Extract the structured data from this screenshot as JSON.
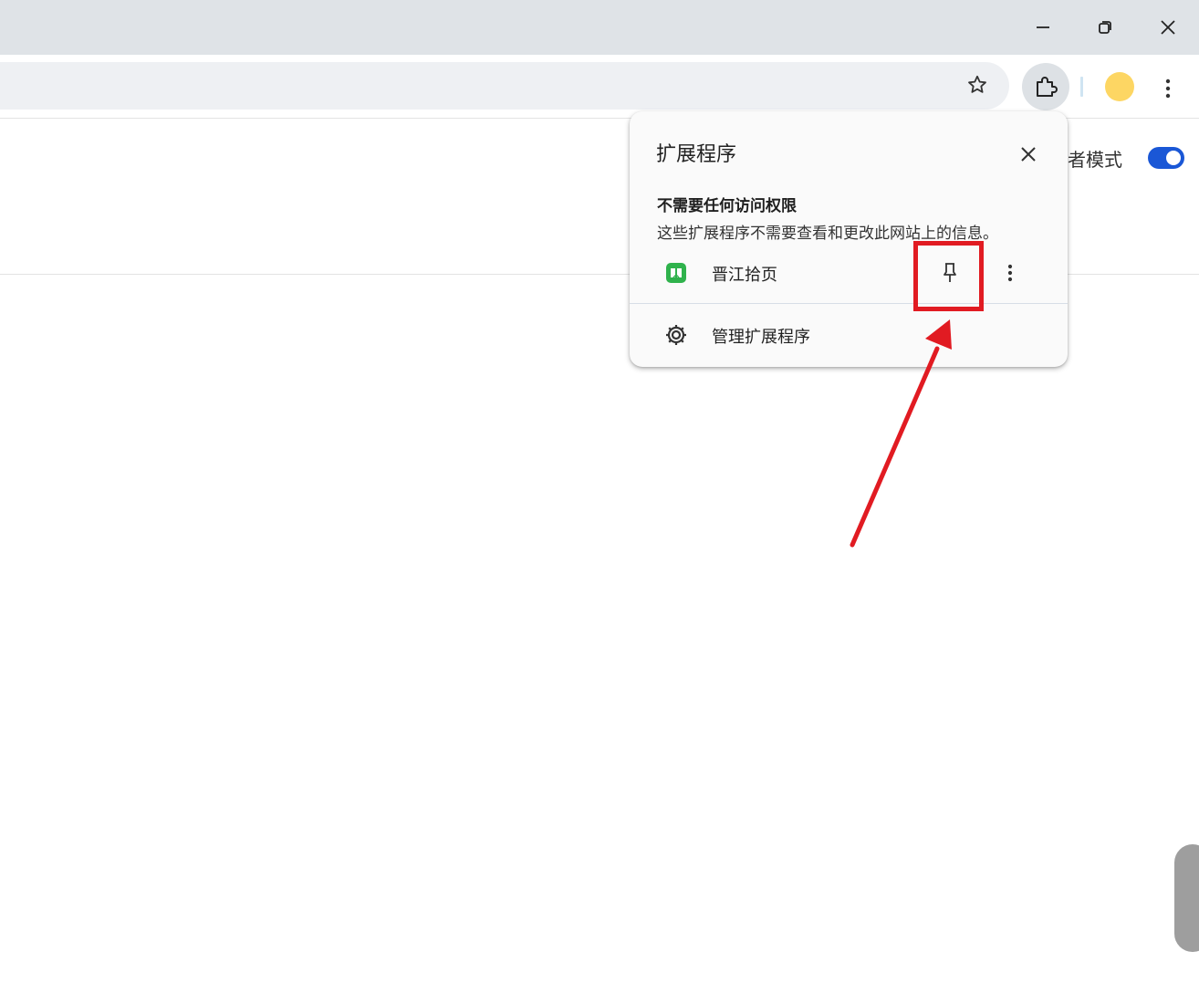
{
  "window": {
    "minimize_label": "Minimize",
    "restore_label": "Restore",
    "close_label": "Close"
  },
  "toolbar": {
    "bookmark_icon": "star-icon",
    "extensions_icon": "puzzle-icon",
    "profile_color": "#fdd663",
    "menu_icon": "kebab-menu-icon"
  },
  "page": {
    "developer_mode_label": "发者模式",
    "developer_mode_on": true
  },
  "popup": {
    "title": "扩展程序",
    "section_heading": "不需要任何访问权限",
    "section_description": "这些扩展程序不需要查看和更改此网站上的信息。",
    "extensions": [
      {
        "name": "晋江拾页",
        "icon_color": "#2fb24c"
      }
    ],
    "manage_label": "管理扩展程序"
  },
  "annotation": {
    "highlight_color": "#e11b22"
  }
}
